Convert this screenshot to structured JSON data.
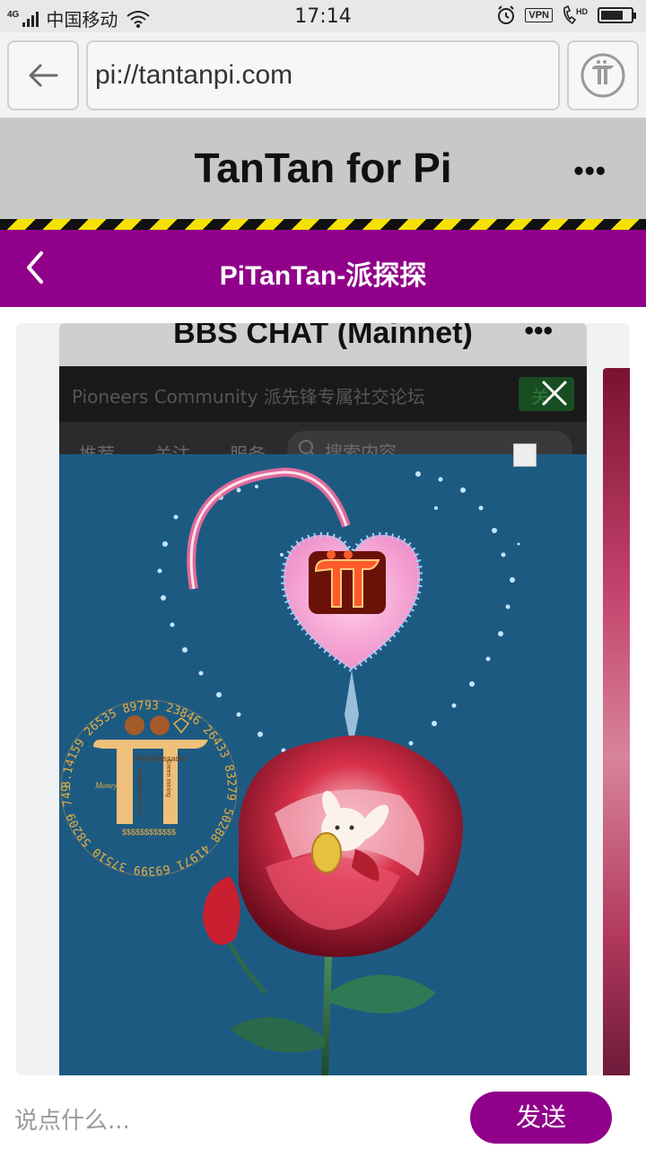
{
  "status_bar": {
    "network": "4G",
    "carrier": "中国移动",
    "time": "17:14",
    "vpn": "VPN",
    "hd": "HD",
    "battery_level": 0.75
  },
  "browser": {
    "url": "pi://tantanpi.com"
  },
  "app_header": {
    "title": "TanTan for Pi",
    "more": "•••"
  },
  "nav": {
    "title": "PiTanTan-派探探"
  },
  "popup": {
    "title": "BBS CHAT (Mainnet)",
    "more": "•••",
    "community": "Pioneers Community 派先锋专属社交论坛",
    "join_button": "关",
    "tabs": [
      "推荐",
      "关注",
      "服务"
    ],
    "search_placeholder": "搜索内容",
    "logo_ring_text": "3.14159 26535 89793 23846 26433 83279 50288 41971 69399 37510 58209 74944",
    "logo_labels": [
      "PiAmbassador",
      "Imagination BTC",
      "Green mining",
      "Money",
      "$$$$$$$$$$$$"
    ]
  },
  "bottom": {
    "input_placeholder": "说点什么...",
    "send_label": "发送"
  },
  "colors": {
    "brand_purple": "#90008a",
    "header_gray": "#c8c8c8",
    "promo_blue": "#1d5a82",
    "hazard_yellow": "#f5e200"
  }
}
